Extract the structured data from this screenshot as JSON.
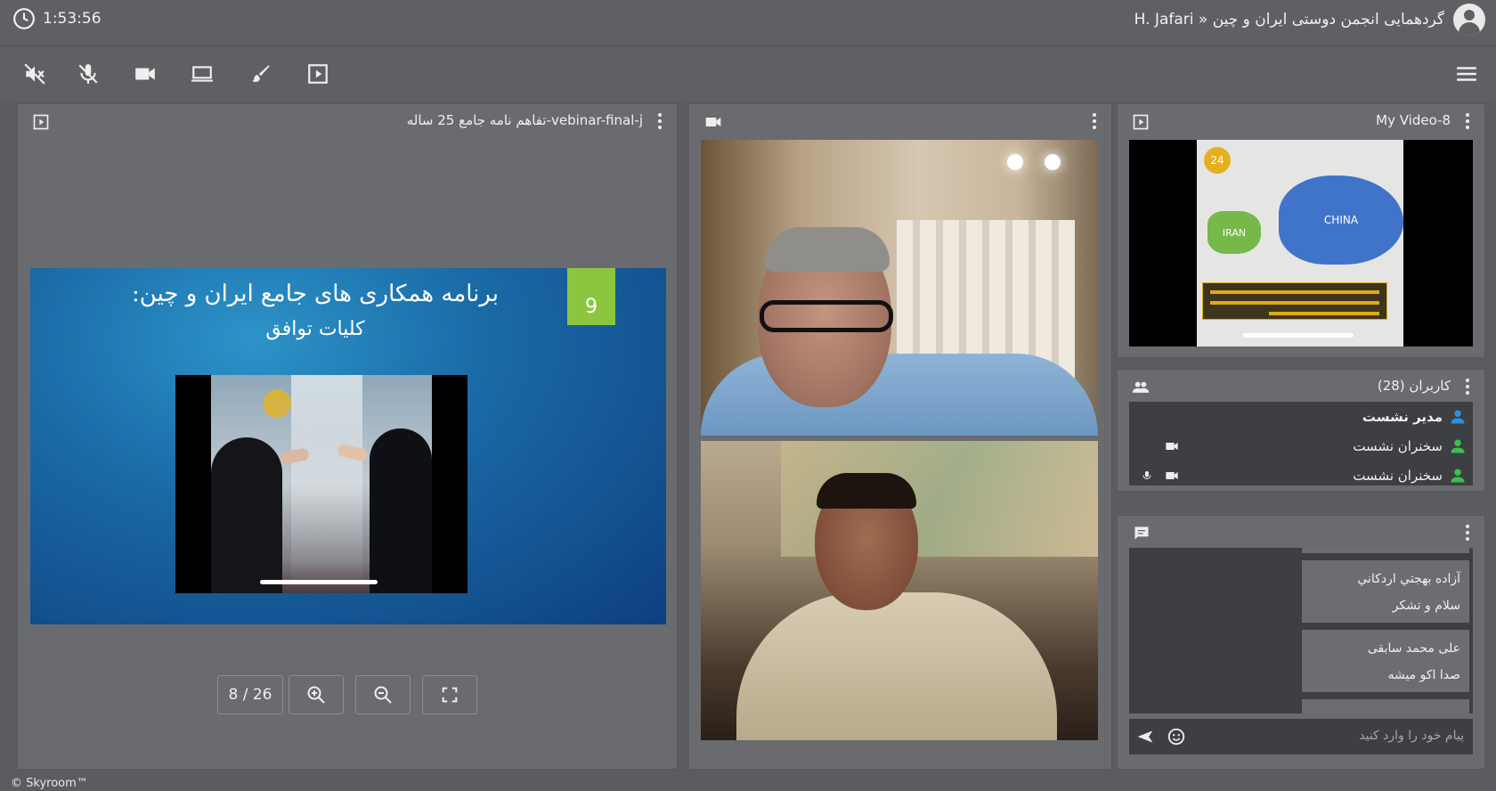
{
  "header": {
    "clock": "1:53:56",
    "room_title": "H. Jafari » گردهمایی انجمن دوستی ایران و چین"
  },
  "toolbar": {
    "tools": [
      "speaker-muted-icon",
      "mic-muted-icon",
      "camera-icon",
      "screen-share-icon",
      "brush-icon",
      "media-play-icon"
    ],
    "menu_icon": "hamburger-menu-icon"
  },
  "presentation": {
    "title": "تفاهم نامه جامع 25 ساله-vebinar-final-j",
    "slide": {
      "number": "9",
      "title": "برنامه همکاری های جامع ایران و چین:",
      "subtitle": "کلیات توافق"
    },
    "pager": "8 / 26",
    "controls": [
      "zoom-in-icon",
      "zoom-out-icon",
      "fullscreen-icon"
    ]
  },
  "video": {
    "header_icon": "camera-icon"
  },
  "my_video": {
    "title": "My Video-8",
    "map_labels": {
      "left": "IRAN",
      "right": "CHINA"
    },
    "logo": "24"
  },
  "users": {
    "title": "کاربران (28)",
    "items": [
      {
        "name": "مدیر نشست",
        "role_color": "#2f8fe0"
      },
      {
        "name": "سخنران نشست",
        "role_color": "#38c24a"
      },
      {
        "name": "سخنران نشست",
        "role_color": "#38c24a"
      }
    ]
  },
  "chat": {
    "messages": [
      {
        "sender": "آزاده بهجتي اردكاني",
        "text": "سلام و تشکر"
      },
      {
        "sender": "علی محمد سابقی",
        "text": "صدا اکو میشه"
      }
    ],
    "placeholder": "پیام خود را وارد کنید"
  },
  "footer": {
    "copyright": "© Skyroom™"
  },
  "colors": {
    "background": "#5a5c60",
    "panel": "#6a6b6f",
    "dark_area": "#3e3f43",
    "slide_badge": "#8cc63f"
  }
}
